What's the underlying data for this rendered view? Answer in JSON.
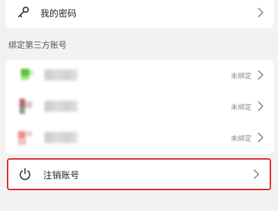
{
  "password_row": {
    "label": "我的密码",
    "icon": "key-icon"
  },
  "third_party": {
    "section_title": "绑定第三方账号",
    "accounts": [
      {
        "status": "未绑定",
        "icon_colors": [
          "#5ac43a",
          "#9be07f"
        ]
      },
      {
        "status": "未绑定",
        "icon_colors": [
          "#b86b6b",
          "#8f9e8f"
        ]
      },
      {
        "status": "未绑定",
        "icon_colors": [
          "#f08f8f",
          "#f4c2c2"
        ]
      }
    ]
  },
  "delete_row": {
    "label": "注销账号",
    "icon": "power-icon",
    "highlight_color": "#e02222"
  }
}
